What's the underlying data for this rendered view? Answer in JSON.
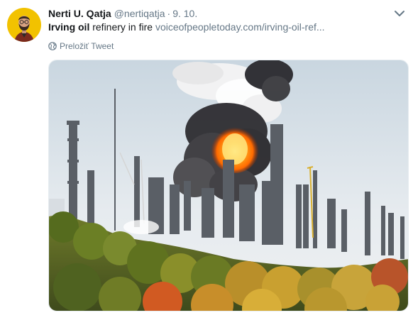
{
  "tweet": {
    "author_name": "Nerti U. Qatja",
    "author_handle": "@nertiqatja",
    "separator": "·",
    "date": "9. 10.",
    "text_bold": "Irving oil",
    "text_rest": " refinery in fire ",
    "link": "voiceofpeopletoday.com/irving-oil-ref...",
    "translate_label": "Preložiť Tweet"
  },
  "icons": {
    "caret": "chevron-down-icon",
    "translate": "globe-icon"
  },
  "colors": {
    "muted": "#657786",
    "text": "#14171a",
    "avatar_bg": "#f2c200"
  }
}
